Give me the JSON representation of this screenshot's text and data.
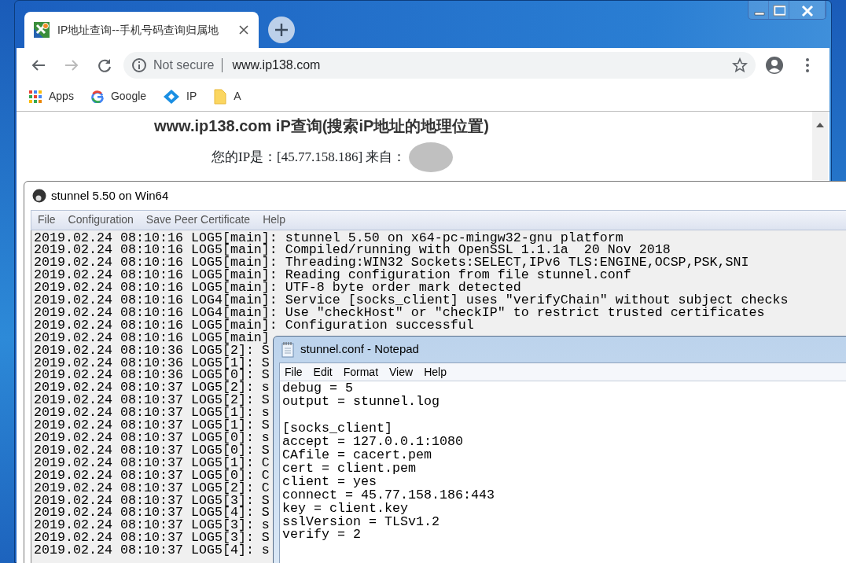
{
  "browser": {
    "tab": {
      "title": "IP地址查询--手机号码查询归属地",
      "selected": true
    },
    "address": {
      "security": "Not secure",
      "url": "www.ip138.com"
    },
    "bookmarks": [
      {
        "label": "Apps",
        "kind": "apps"
      },
      {
        "label": "Google",
        "kind": "google"
      },
      {
        "label": "IP",
        "kind": "site"
      },
      {
        "label": "A",
        "kind": "folder"
      }
    ],
    "page": {
      "heading": "www.ip138.com iP查询(搜索iP地址的地理位置)",
      "ip_line": "您的IP是：[45.77.158.186] 来自："
    }
  },
  "stunnel": {
    "title": "stunnel 5.50 on Win64",
    "menu": [
      "File",
      "Configuration",
      "Save Peer Certificate",
      "Help"
    ],
    "log": [
      "2019.02.24 08:10:16 LOG5[main]: stunnel 5.50 on x64-pc-mingw32-gnu platform",
      "2019.02.24 08:10:16 LOG5[main]: Compiled/running with OpenSSL 1.1.1a  20 Nov 2018",
      "2019.02.24 08:10:16 LOG5[main]: Threading:WIN32 Sockets:SELECT,IPv6 TLS:ENGINE,OCSP,PSK,SNI",
      "2019.02.24 08:10:16 LOG5[main]: Reading configuration from file stunnel.conf",
      "2019.02.24 08:10:16 LOG5[main]: UTF-8 byte order mark detected",
      "2019.02.24 08:10:16 LOG4[main]: Service [socks_client] uses \"verifyChain\" without subject checks",
      "2019.02.24 08:10:16 LOG4[main]: Use \"checkHost\" or \"checkIP\" to restrict trusted certificates",
      "2019.02.24 08:10:16 LOG5[main]: Configuration successful",
      "2019.02.24 08:10:16 LOG5[main]",
      "2019.02.24 08:10:36 LOG5[2]: S",
      "2019.02.24 08:10:36 LOG5[1]: S",
      "2019.02.24 08:10:36 LOG5[0]: S",
      "2019.02.24 08:10:37 LOG5[2]: s",
      "2019.02.24 08:10:37 LOG5[2]: S",
      "2019.02.24 08:10:37 LOG5[1]: s",
      "2019.02.24 08:10:37 LOG5[1]: S",
      "2019.02.24 08:10:37 LOG5[0]: s",
      "2019.02.24 08:10:37 LOG5[0]: S",
      "2019.02.24 08:10:37 LOG5[1]: C",
      "2019.02.24 08:10:37 LOG5[0]: C",
      "2019.02.24 08:10:37 LOG5[2]: C",
      "2019.02.24 08:10:37 LOG5[3]: S",
      "2019.02.24 08:10:37 LOG5[4]: S",
      "2019.02.24 08:10:37 LOG5[3]: s",
      "2019.02.24 08:10:37 LOG5[3]: S",
      "2019.02.24 08:10:37 LOG5[4]: s"
    ]
  },
  "notepad": {
    "title": "stunnel.conf - Notepad",
    "menu": [
      "File",
      "Edit",
      "Format",
      "View",
      "Help"
    ],
    "sections": [
      [
        "debug = 5",
        "output = stunnel.log"
      ],
      [
        "[socks_client]",
        "accept = 127.0.0.1:1080",
        "CAfile = cacert.pem",
        "cert = client.pem",
        "client = yes",
        "connect = 45.77.158.186:443",
        "key = client.key",
        "sslVersion = TLSv1.2",
        "verify = 2"
      ]
    ]
  }
}
